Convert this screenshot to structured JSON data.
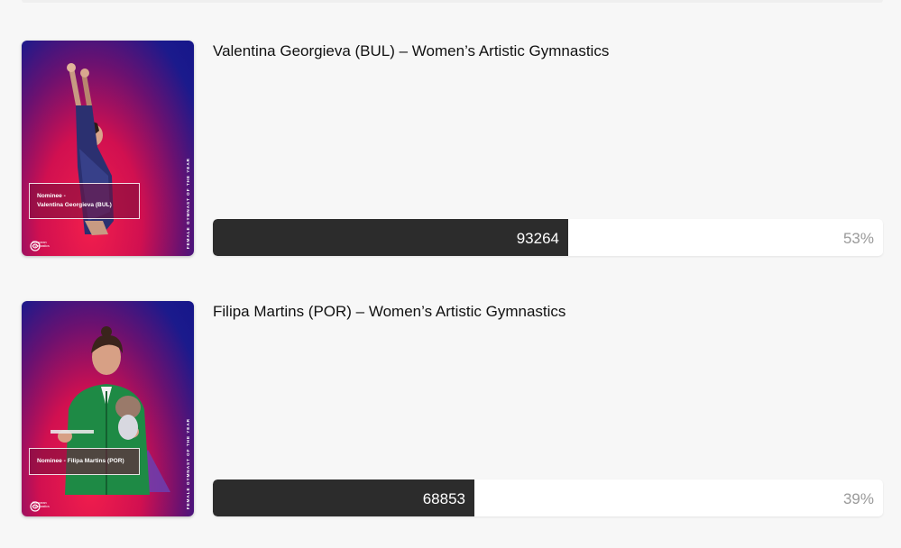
{
  "nominees": [
    {
      "title": "Valentina Georgieva (BUL) – Women’s Artistic Gymnastics",
      "card_label_line1": "Nominee -",
      "card_label_line2": "Valentina Georgieva (BUL)",
      "card_vertical_text": "FEMALE GYMNAST OF THE YEAR",
      "logo_line1": "European",
      "logo_line2": "Gymnastics",
      "votes": "93264",
      "percent": "53%",
      "share": 0.53
    },
    {
      "title": "Filipa Martins (POR) – Women’s Artistic Gymnastics",
      "card_label_line1": "Nominee - Filipa Martins (POR)",
      "card_vertical_text": "FEMALE GYMNAST OF THE YEAR",
      "logo_line1": "European",
      "logo_line2": "Gymnastics",
      "votes": "68853",
      "percent": "39%",
      "share": 0.39
    }
  ],
  "colors": {
    "bar_fill": "#2c2c2c",
    "bar_track": "#ffffff",
    "page_bg": "#f7f7f7",
    "percent_text": "#9a9a9a"
  }
}
